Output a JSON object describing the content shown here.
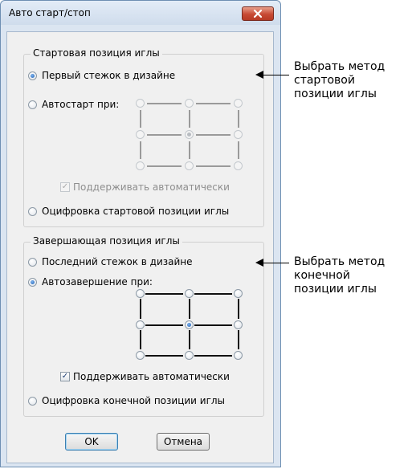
{
  "dialog": {
    "title": "Авто старт/стоп",
    "close_icon": "close-x-icon"
  },
  "start_group": {
    "title": "Стартовая позиция иглы",
    "first_stitch_label": "Первый стежок в дизайне",
    "first_stitch_selected": true,
    "autostart_label": "Автостарт при:",
    "autostart_selected": false,
    "grid_selected_point": "center",
    "maintain_auto_label": "Поддерживать автоматически",
    "maintain_auto_checked": true,
    "maintain_auto_enabled": false,
    "digitize_label": "Оцифровка стартовой позиции иглы",
    "digitize_selected": false
  },
  "end_group": {
    "title": "Завершающая позиция иглы",
    "last_stitch_label": "Последний стежок в дизайне",
    "last_stitch_selected": false,
    "autoend_label": "Автозавершение при:",
    "autoend_selected": true,
    "grid_selected_point": "center",
    "maintain_auto_label": "Поддерживать автоматически",
    "maintain_auto_checked": true,
    "maintain_auto_enabled": true,
    "digitize_label": "Оцифровка конечной позиции иглы",
    "digitize_selected": false
  },
  "buttons": {
    "ok_label": "OK",
    "cancel_label": "Отмена"
  },
  "annotations": {
    "start_note": [
      "Выбрать метод",
      "стартовой",
      "позиции иглы"
    ],
    "end_note": [
      "Выбрать метод",
      "конечной",
      "позиции иглы"
    ]
  }
}
